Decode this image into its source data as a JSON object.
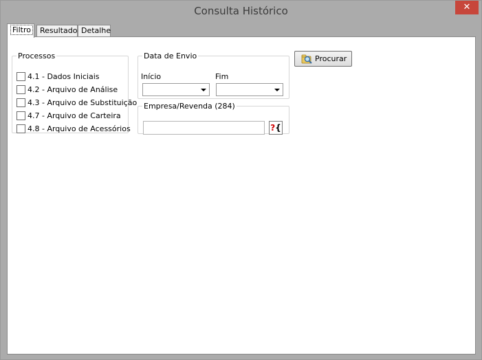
{
  "window": {
    "title": "Consulta Histórico",
    "close_glyph": "✕"
  },
  "tabs": [
    {
      "label": "Filtro",
      "active": true
    },
    {
      "label": "Resultado",
      "active": false
    },
    {
      "label": "Detalhe",
      "active": false
    }
  ],
  "processos": {
    "legend": "Processos",
    "items": [
      {
        "label": "4.1 - Dados Iniciais",
        "checked": false
      },
      {
        "label": "4.2 - Arquivo de Análise",
        "checked": false
      },
      {
        "label": "4.3 - Arquivo de Substituição",
        "checked": false
      },
      {
        "label": "4.7 - Arquivo de Carteira",
        "checked": false
      },
      {
        "label": "4.8 - Arquivo de Acessórios",
        "checked": false
      }
    ]
  },
  "data_envio": {
    "legend": "Data de Envio",
    "inicio_label": "Início",
    "inicio_value": "",
    "fim_label": "Fim",
    "fim_value": ""
  },
  "empresa": {
    "legend": "Empresa/Revenda (284)",
    "value": "",
    "help_icon": "question-bracket-icon"
  },
  "actions": {
    "procurar_label": "Procurar",
    "procurar_icon": "search-folder-icon"
  }
}
